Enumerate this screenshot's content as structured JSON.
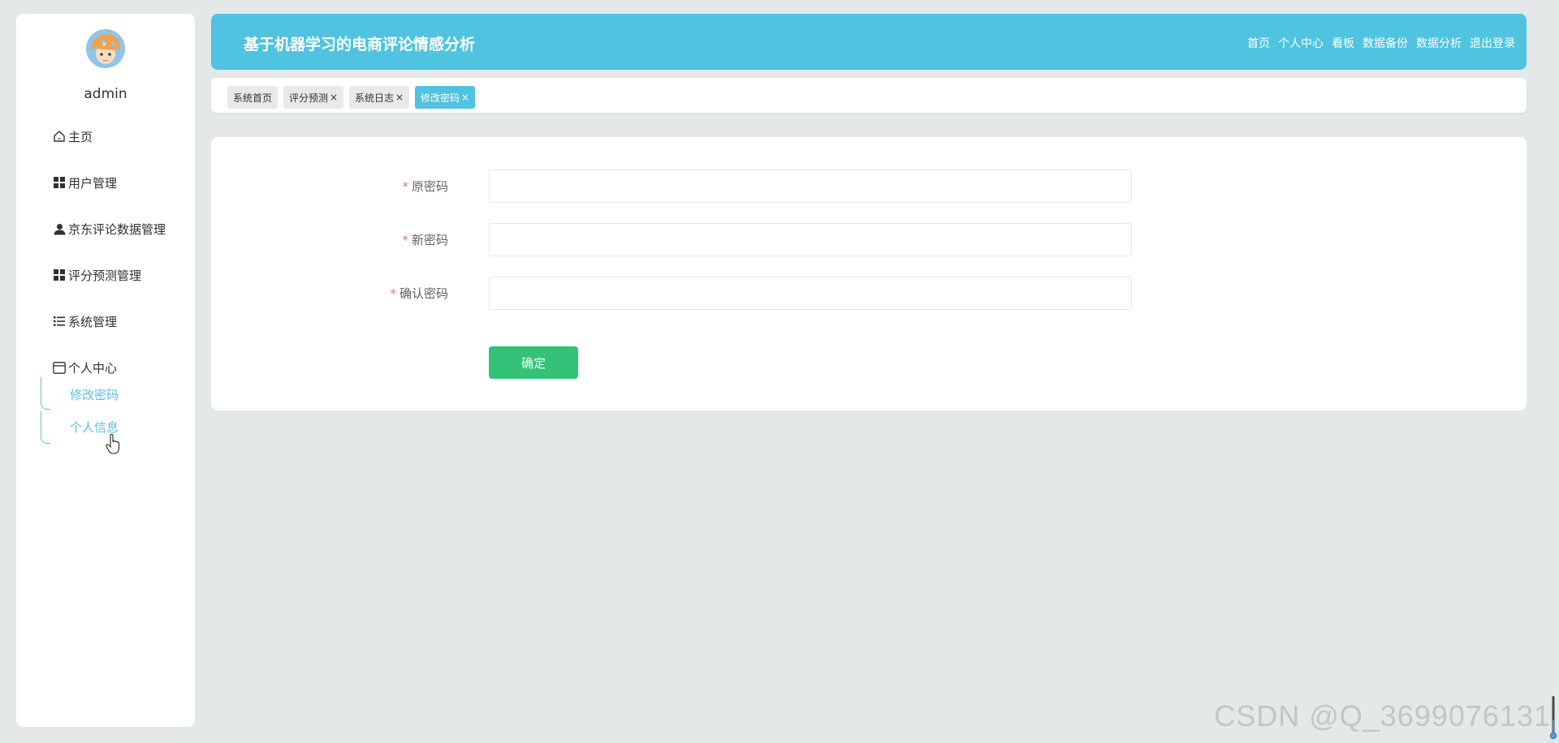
{
  "sidebar": {
    "username": "admin",
    "items": [
      {
        "label": "主页",
        "icon": "home-icon"
      },
      {
        "label": "用户管理",
        "icon": "grid-icon"
      },
      {
        "label": "京东评论数据管理",
        "icon": "user-icon"
      },
      {
        "label": "评分预测管理",
        "icon": "grid-icon"
      },
      {
        "label": "系统管理",
        "icon": "list-icon"
      },
      {
        "label": "个人中心",
        "icon": "window-icon"
      }
    ],
    "subitems": [
      {
        "label": "修改密码"
      },
      {
        "label": "个人信息"
      }
    ]
  },
  "header": {
    "title": "基于机器学习的电商评论情感分析",
    "nav": [
      "首页",
      "个人中心",
      "看板",
      "数据备份",
      "数据分析",
      "退出登录"
    ]
  },
  "tabs": [
    {
      "label": "系统首页",
      "closable": false,
      "active": false
    },
    {
      "label": "评分预测",
      "closable": true,
      "active": false
    },
    {
      "label": "系统日志",
      "closable": true,
      "active": false
    },
    {
      "label": "修改密码",
      "closable": true,
      "active": true
    }
  ],
  "tab_close_glyph": "×",
  "form": {
    "required_mark": "*",
    "fields": [
      {
        "label": "原密码",
        "value": ""
      },
      {
        "label": "新密码",
        "value": ""
      },
      {
        "label": "确认密码",
        "value": ""
      }
    ],
    "submit_label": "确定"
  },
  "watermark": "CSDN @Q_3699076131",
  "colors": {
    "accent": "#4fc3df",
    "confirm": "#34c178",
    "required": "#f56c6c",
    "background": "#e4e8e8"
  }
}
